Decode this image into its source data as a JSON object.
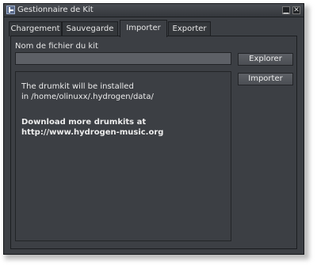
{
  "window": {
    "title": "Gestionnaire de Kit",
    "minimize_glyph": "▁",
    "close_glyph": "✕"
  },
  "tabs": [
    {
      "label": "Chargement",
      "active": false
    },
    {
      "label": "Sauvegarde",
      "active": false
    },
    {
      "label": "Importer",
      "active": true
    },
    {
      "label": "Exporter",
      "active": false
    }
  ],
  "import": {
    "filename_label": "Nom de fichier du kit",
    "filename_value": "",
    "browse_label": "Explorer",
    "import_label": "Importer",
    "info_line1": "The drumkit will be installed",
    "info_line2": "in /home/olinuxx/.hydrogen/data/",
    "download_line1": "Download more drumkits at",
    "download_line2": "http://www.hydrogen-music.org"
  },
  "icons": {
    "app": "hydrogen-app-icon",
    "minimize": "minimize-icon",
    "close": "close-icon"
  },
  "colors": {
    "window_bg": "#3c3f44",
    "field_bg": "#5d6066",
    "text": "#e6e6e6"
  }
}
